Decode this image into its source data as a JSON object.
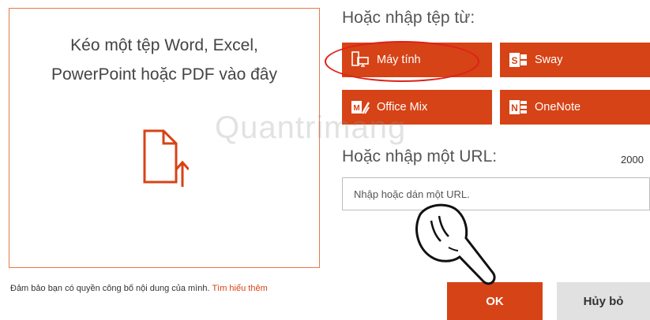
{
  "dropzone": {
    "line1": "Kéo một tệp Word, Excel,",
    "line2": "PowerPoint hoặc PDF vào đây",
    "icon": "file-upload-icon"
  },
  "notice": {
    "text": "Đảm bảo bạn có quyền công bố nội dung của mình.",
    "link": "Tìm hiểu thêm"
  },
  "import": {
    "title": "Hoặc nhập tệp từ:",
    "sources": [
      {
        "label": "Máy tính",
        "icon": "computer-icon"
      },
      {
        "label": "Sway",
        "icon": "sway-icon"
      },
      {
        "label": "Office Mix",
        "icon": "office-mix-icon"
      },
      {
        "label": "OneNote",
        "icon": "onenote-icon"
      }
    ]
  },
  "url": {
    "title": "Hoặc nhập một URL:",
    "counter": "2000",
    "placeholder": "Nhập hoặc dán một URL."
  },
  "buttons": {
    "ok": "OK",
    "cancel": "Hủy bỏ"
  },
  "watermark": "Quantrimang",
  "colors": {
    "accent": "#d64316",
    "highlight_circle": "#e0201a",
    "border": "#e47a4a"
  }
}
